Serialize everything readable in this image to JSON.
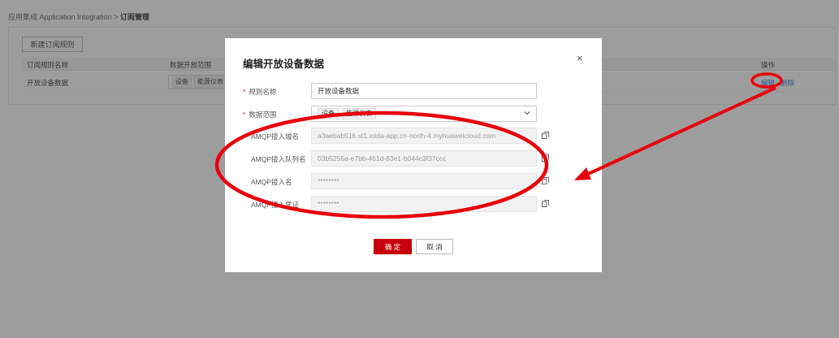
{
  "breadcrumb": {
    "parent": "应用集成 Application Integration",
    "sep": ">",
    "current": "订阅管理"
  },
  "toolbar": {
    "new_rule": "新建订阅规则"
  },
  "table": {
    "col_name": "订阅规则名称",
    "col_scope": "数据开放范围",
    "col_action": "操作",
    "rows": [
      {
        "name": "开放设备数据",
        "tags": [
          "设备",
          "能源仪表"
        ],
        "edit": "编辑",
        "delete": "删除"
      }
    ]
  },
  "modal": {
    "title": "编辑开放设备数据",
    "close": "×",
    "rule_name_label": "规则名称",
    "rule_name_value": "开放设备数据",
    "scope_label": "数据范围",
    "scope_tags": [
      "设备",
      "能源仪表"
    ],
    "host_label": "AMQP接入域名",
    "host_value": "a3aebab516.st1.iotda-app.cn-north-4.myhuaweicloud.com",
    "queue_label": "AMQP接入队列名",
    "queue_value": "03b5255a-e7bb-461d-83e1-b044c3f37ccc",
    "name_label": "AMQP接入名",
    "name_value": "********",
    "cred_label": "AMQP接入凭证",
    "cred_value": "********",
    "ok": "确 定",
    "cancel": "取 消"
  },
  "colors": {
    "primary": "#c7000b",
    "link": "#2a6ed8",
    "annotation": "#e8000b"
  }
}
